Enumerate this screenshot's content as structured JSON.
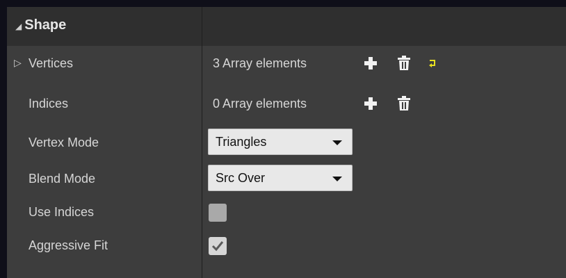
{
  "section": {
    "title": "Shape"
  },
  "rows": {
    "vertices": {
      "label": "Vertices",
      "value": "3 Array elements"
    },
    "indices": {
      "label": "Indices",
      "value": "0 Array elements"
    },
    "vertex_mode": {
      "label": "Vertex Mode",
      "selected": "Triangles"
    },
    "blend_mode": {
      "label": "Blend Mode",
      "selected": "Src Over"
    },
    "use_indices": {
      "label": "Use Indices",
      "checked": false
    },
    "aggressive_fit": {
      "label": "Aggressive Fit",
      "checked": true
    }
  },
  "icons": {
    "add": "plus-icon",
    "delete": "trash-icon",
    "reset": "reset-to-default-icon",
    "collapse": "triangle-down-icon",
    "expand": "triangle-right-icon",
    "dropdown": "caret-down-icon",
    "check": "check-icon"
  },
  "colors": {
    "panel_bg": "#3d3d3d",
    "header_bg": "#2f2f2f",
    "outer_bg": "#0f0f19",
    "reset_icon": "#e8e020"
  }
}
